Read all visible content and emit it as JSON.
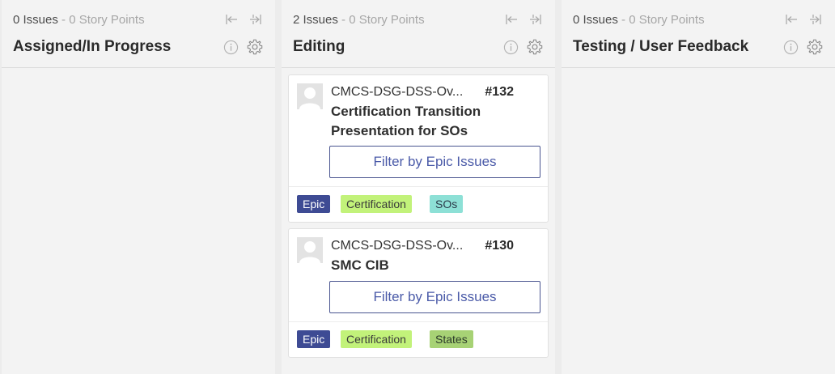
{
  "columns": [
    {
      "stats_issues": "0 Issues",
      "stats_sep": " - ",
      "stats_points": "0 Story Points",
      "title": "Assigned/In Progress",
      "cards": []
    },
    {
      "stats_issues": "2 Issues",
      "stats_sep": " - ",
      "stats_points": "0 Story Points",
      "title": "Editing",
      "cards": [
        {
          "repo": "CMCS-DSG-DSS-Ov...",
          "number": "#132",
          "title": "Certification Transition Presentation for SOs",
          "filter_label": "Filter by Epic Issues",
          "labels": [
            "Epic",
            "Certification",
            "SOs"
          ]
        },
        {
          "repo": "CMCS-DSG-DSS-Ov...",
          "number": "#130",
          "title": "SMC CIB",
          "filter_label": "Filter by Epic Issues",
          "labels": [
            "Epic",
            "Certification",
            "States"
          ]
        }
      ]
    },
    {
      "stats_issues": "0 Issues",
      "stats_sep": " - ",
      "stats_points": "0 Story Points",
      "title": "Testing / User Feedback",
      "cards": []
    }
  ],
  "icons": {
    "collapse_left": "collapse-left-icon",
    "collapse_right": "collapse-right-icon",
    "info": "info-icon",
    "settings": "gear-icon",
    "avatar": "avatar-icon"
  },
  "colors": {
    "board_bg": "#ececec",
    "column_bg": "#f3f3f3",
    "epic_label": "#3e4b94",
    "certification_label": "#c2f27a",
    "sos_label": "#8de0d6",
    "states_label": "#a7d275",
    "filter_button_text": "#4a5aa8"
  }
}
